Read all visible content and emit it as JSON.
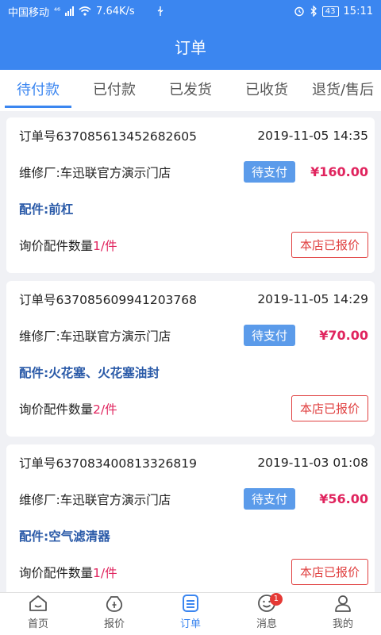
{
  "status_bar": {
    "carrier": "中国移动",
    "network": "⁴⁶",
    "speed": "7.64K/s",
    "battery": "43",
    "time": "15:11"
  },
  "header": {
    "title": "订单"
  },
  "tabs": [
    {
      "label": "待付款",
      "active": true
    },
    {
      "label": "已付款",
      "active": false
    },
    {
      "label": "已发货",
      "active": false
    },
    {
      "label": "已收货",
      "active": false
    },
    {
      "label": "退货/售后",
      "active": false
    }
  ],
  "orders": [
    {
      "order_no": "订单号637085613452682605",
      "date": "2019-11-05 14:35",
      "shop": "维修厂:车迅联官方演示门店",
      "status": "待支付",
      "price": "¥160.00",
      "parts": "配件:前杠",
      "count_label": "询价配件数量",
      "count_value": "1/件",
      "action": "本店已报价"
    },
    {
      "order_no": "订单号637085609941203768",
      "date": "2019-11-05 14:29",
      "shop": "维修厂:车迅联官方演示门店",
      "status": "待支付",
      "price": "¥70.00",
      "parts": "配件:火花塞、火花塞油封",
      "count_label": "询价配件数量",
      "count_value": "2/件",
      "action": "本店已报价"
    },
    {
      "order_no": "订单号637083400813326819",
      "date": "2019-11-03 01:08",
      "shop": "维修厂:车迅联官方演示门店",
      "status": "待支付",
      "price": "¥56.00",
      "parts": "配件:空气滤清器",
      "count_label": "询价配件数量",
      "count_value": "1/件",
      "action": "本店已报价"
    }
  ],
  "bottom_nav": [
    {
      "label": "首页",
      "icon": "home-icon",
      "active": false
    },
    {
      "label": "报价",
      "icon": "quote-icon",
      "active": false
    },
    {
      "label": "订单",
      "icon": "orders-icon",
      "active": true
    },
    {
      "label": "消息",
      "icon": "message-icon",
      "active": false,
      "badge": "1"
    },
    {
      "label": "我的",
      "icon": "profile-icon",
      "active": false
    }
  ],
  "colors": {
    "primary": "#3b86f0",
    "price": "#e0245e",
    "parts": "#2a5aa8",
    "action_border": "#e04040"
  }
}
